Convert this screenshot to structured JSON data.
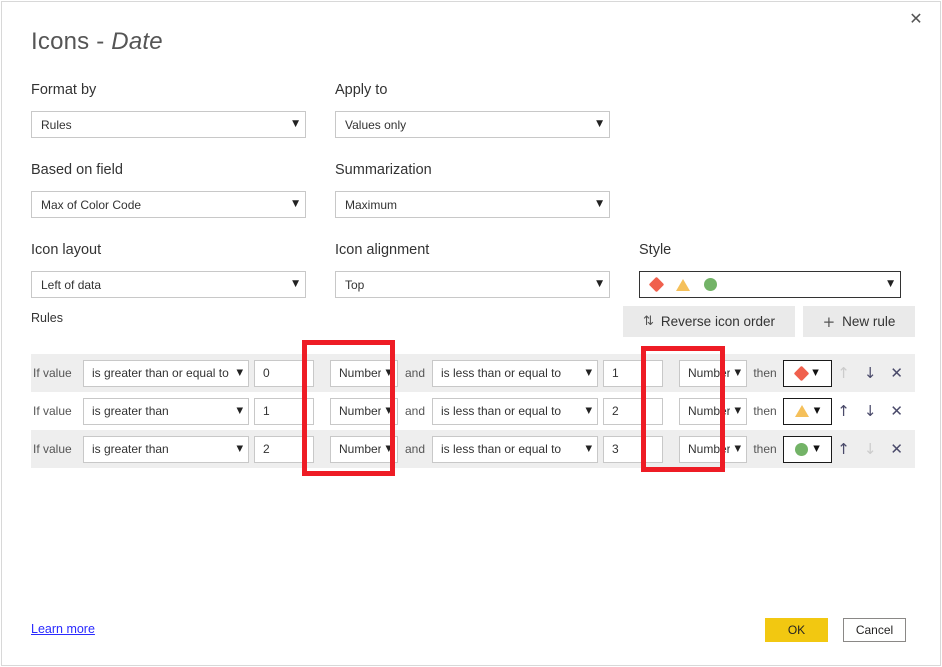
{
  "dialog": {
    "title_main": "Icons - ",
    "title_em": "Date",
    "close_label": "✕"
  },
  "fields": {
    "format_by": {
      "label": "Format by",
      "value": "Rules"
    },
    "apply_to": {
      "label": "Apply to",
      "value": "Values only"
    },
    "based_on_field": {
      "label": "Based on field",
      "value": "Max of Color Code"
    },
    "summarization": {
      "label": "Summarization",
      "value": "Maximum"
    },
    "icon_layout": {
      "label": "Icon layout",
      "value": "Left of data"
    },
    "icon_alignment": {
      "label": "Icon alignment",
      "value": "Top"
    },
    "style": {
      "label": "Style",
      "icons": [
        "diamond",
        "triangle",
        "circle"
      ]
    }
  },
  "rules_section": {
    "label": "Rules",
    "reverse_button": {
      "label": "Reverse icon order",
      "icon": "updown-arrows-icon",
      "glyph": "⇅"
    },
    "new_rule_button": {
      "label": "New rule",
      "icon": "plus-icon",
      "glyph": "+"
    },
    "if_value_label": "If value",
    "and_label": "and",
    "then_label": "then",
    "rows": [
      {
        "operator1": "is greater than or equal to",
        "value1": "0",
        "type1": "Number",
        "operator2": "is less than or equal to",
        "value2": "1",
        "type2": "Number",
        "icon": "diamond",
        "up_enabled": false,
        "down_enabled": true
      },
      {
        "operator1": "is greater than",
        "value1": "1",
        "type1": "Number",
        "operator2": "is less than or equal to",
        "value2": "2",
        "type2": "Number",
        "icon": "triangle",
        "up_enabled": true,
        "down_enabled": true
      },
      {
        "operator1": "is greater than",
        "value1": "2",
        "type1": "Number",
        "operator2": "is less than or equal to",
        "value2": "3",
        "type2": "Number",
        "icon": "circle",
        "up_enabled": true,
        "down_enabled": false
      }
    ],
    "row_action_glyphs": {
      "up": "↑",
      "down": "↓",
      "remove": "✕"
    }
  },
  "footer": {
    "learn_more": "Learn more",
    "ok": "OK",
    "cancel": "Cancel"
  },
  "colors": {
    "diamond": "#f0604d",
    "triangle": "#f5c05a",
    "circle": "#73b367",
    "ok_button": "#f2c811",
    "highlight": "#ee1c25",
    "link": "#2a2aff"
  },
  "highlights": [
    {
      "name": "type1-column-highlight"
    },
    {
      "name": "type2-column-highlight"
    }
  ]
}
